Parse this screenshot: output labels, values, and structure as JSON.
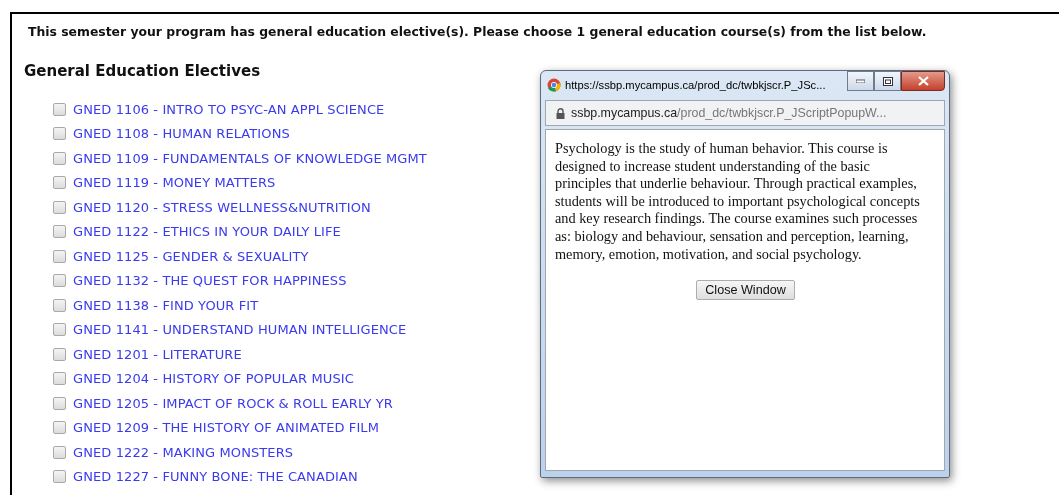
{
  "notice": "This semester your program has general education elective(s). Please choose 1 general education course(s) from the list below.",
  "section_title": "General Education Electives",
  "courses": [
    {
      "label": "GNED 1106 - INTRO TO PSYC-AN APPL SCIENCE",
      "checked": false
    },
    {
      "label": "GNED 1108 - HUMAN RELATIONS",
      "checked": false
    },
    {
      "label": "GNED 1109 - FUNDAMENTALS OF KNOWLEDGE MGMT",
      "checked": false
    },
    {
      "label": "GNED 1119 - MONEY MATTERS",
      "checked": false
    },
    {
      "label": "GNED 1120 - STRESS WELLNESS&NUTRITION",
      "checked": false
    },
    {
      "label": "GNED 1122 - ETHICS IN YOUR DAILY LIFE",
      "checked": false
    },
    {
      "label": "GNED 1125 - GENDER & SEXUALITY",
      "checked": false
    },
    {
      "label": "GNED 1132 - THE QUEST FOR HAPPINESS",
      "checked": false
    },
    {
      "label": "GNED 1138 - FIND YOUR FIT",
      "checked": false
    },
    {
      "label": "GNED 1141 - UNDERSTAND HUMAN INTELLIGENCE",
      "checked": false
    },
    {
      "label": "GNED 1201 - LITERATURE",
      "checked": false
    },
    {
      "label": "GNED 1204 - HISTORY OF POPULAR MUSIC",
      "checked": false
    },
    {
      "label": "GNED 1205 - IMPACT OF ROCK & ROLL EARLY YR",
      "checked": false
    },
    {
      "label": "GNED 1209 - THE HISTORY OF ANIMATED FILM",
      "checked": false
    },
    {
      "label": "GNED 1222 - MAKING MONSTERS",
      "checked": false
    },
    {
      "label": "GNED 1227 - FUNNY BONE: THE CANADIAN",
      "checked": false
    }
  ],
  "popup": {
    "title": "https://ssbp.mycampus.ca/prod_dc/twbkjscr.P_JSc...",
    "address_host": "ssbp.mycampus.ca",
    "address_path": "/prod_dc/twbkjscr.P_JScriptPopupW...",
    "description": "Psychology is the study of human behavior. This course is designed to increase student understanding of the basic principles that underlie behaviour. Through practical examples, students will be introduced to important psychological concepts and key research findings. The course examines such processes as: biology and behaviour, sensation and perception, learning, memory, emotion, motivation, and social psychology.",
    "button": "Close Window"
  }
}
